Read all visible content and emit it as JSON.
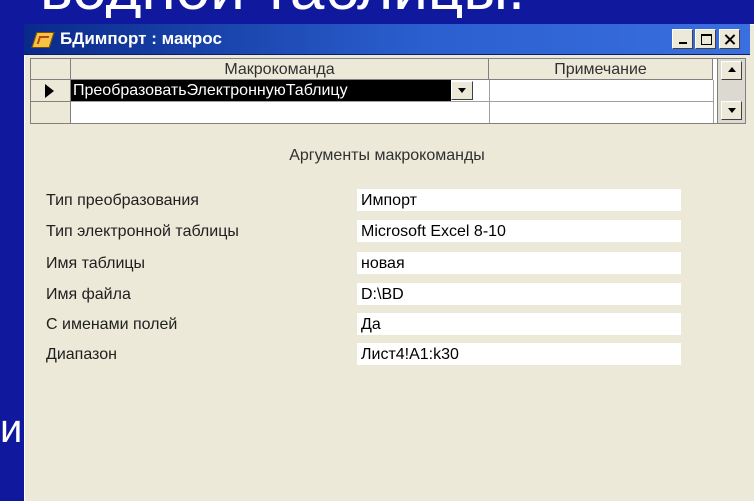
{
  "window": {
    "title": "БДимпорт : макрос"
  },
  "grid": {
    "col_macro": "Макрокоманда",
    "col_note": "Примечание",
    "rows": [
      {
        "macro": "ПреобразоватьЭлектроннуюТаблицу",
        "note": ""
      }
    ]
  },
  "arguments": {
    "heading": "Аргументы макрокоманды",
    "items": [
      {
        "label": "Тип преобразования",
        "value": "Импорт"
      },
      {
        "label": "Тип электронной таблицы",
        "value": "Microsoft Excel 8-10"
      },
      {
        "label": "Имя таблицы",
        "value": "новая"
      },
      {
        "label": "Имя файла",
        "value": "D:\\BD"
      },
      {
        "label": "С именами полей",
        "value": "Да"
      },
      {
        "label": "Диапазон",
        "value": "Лист4!A1:k30"
      }
    ]
  },
  "slide": {
    "title_fragment": "водной таблицы.",
    "left_fragment": "и"
  },
  "colors": {
    "slide_background": "#10189e",
    "titlebar": "#2b5fcf",
    "window_body": "#ece9d8"
  }
}
